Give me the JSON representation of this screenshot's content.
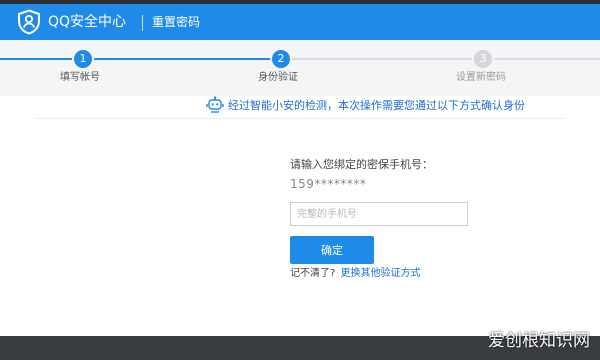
{
  "header": {
    "app_title": "QQ安全中心",
    "page_name": "重置密码",
    "logo_icon": "shield-person-icon"
  },
  "steps": [
    {
      "number": "1",
      "label": "填写帐号",
      "state": "done"
    },
    {
      "number": "2",
      "label": "身份验证",
      "state": "current"
    },
    {
      "number": "3",
      "label": "设置新密码",
      "state": "todo"
    }
  ],
  "notice": {
    "icon": "robot-icon",
    "text": "经过智能小安的检测，本次操作需要您通过以下方式确认身份"
  },
  "form": {
    "prompt": "请输入您绑定的密保手机号：",
    "masked_phone": "159********",
    "input_placeholder": "完整的手机号",
    "input_value": "",
    "confirm_label": "确定",
    "forgot_label": "记不清了?",
    "forgot_link": "更换其他验证方式"
  },
  "watermark": "爱创根知识网",
  "colors": {
    "brand_blue": "#1f8ae8",
    "link_blue": "#1f6fd1",
    "inactive_gray": "#d4d6d9"
  }
}
